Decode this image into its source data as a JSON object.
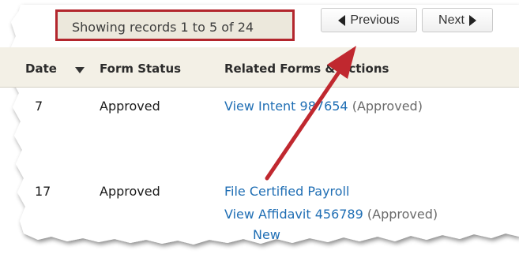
{
  "pager": {
    "showing_text": "Showing records 1 to 5 of 24",
    "previous_label": "Previous",
    "next_label": "Next"
  },
  "table": {
    "headers": {
      "date": "Date",
      "form_status": "Form Status",
      "related": "Related Forms & Actions"
    },
    "rows": [
      {
        "date": "7",
        "status": "Approved",
        "actions": [
          {
            "link": "View Intent 987654",
            "note": "(Approved)"
          }
        ]
      },
      {
        "date": "17",
        "status": "Approved",
        "actions": [
          {
            "link": "File Certified Payroll",
            "note": ""
          },
          {
            "link": "View Affidavit 456789",
            "note": "(Approved)"
          },
          {
            "link": "New",
            "note": ""
          }
        ]
      }
    ]
  },
  "colors": {
    "highlight_border": "#b3262d",
    "arrow": "#c0282f",
    "link": "#1f6eb4",
    "header_bg": "#f3f0e6"
  }
}
